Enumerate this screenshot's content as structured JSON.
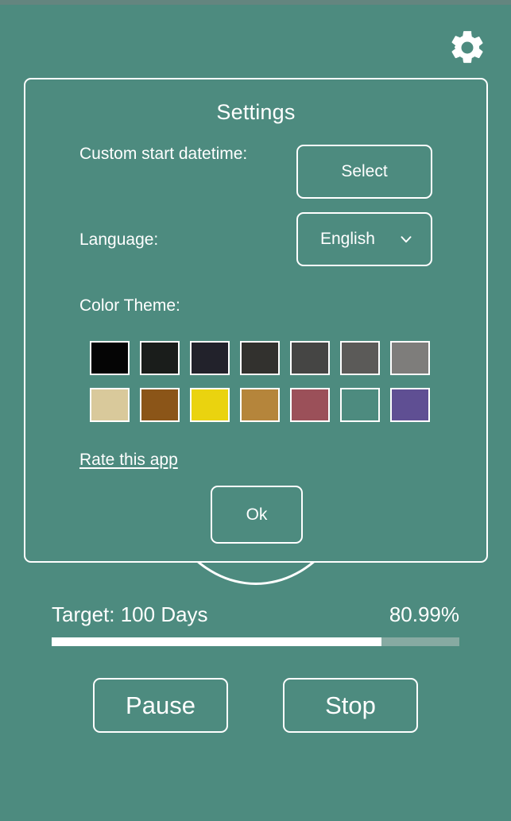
{
  "theme": {
    "background": "#4d8b7f",
    "foreground": "#ffffff",
    "status_bar": "#64857f",
    "progress_track": "#87aaa2"
  },
  "topbar": {
    "gear_icon": "gear-icon"
  },
  "dialog": {
    "title": "Settings",
    "rows": [
      {
        "label": "Custom start datetime:",
        "button_label": "Select"
      },
      {
        "label": "Language:",
        "value": "English",
        "chevron_icon": "chevron-down-icon"
      }
    ],
    "color_theme": {
      "label": "Color Theme:",
      "rows": [
        [
          {
            "name": "swatch-black",
            "color": "#050505"
          },
          {
            "name": "swatch-near-black",
            "color": "#1a1d1b"
          },
          {
            "name": "swatch-dark-navy",
            "color": "#22222b"
          },
          {
            "name": "swatch-dark-gray",
            "color": "#32312e"
          },
          {
            "name": "swatch-gray-1",
            "color": "#454544"
          },
          {
            "name": "swatch-gray-2",
            "color": "#5b5a58"
          },
          {
            "name": "swatch-gray-3",
            "color": "#7e7d7b"
          }
        ],
        [
          {
            "name": "swatch-sand",
            "color": "#d9c99b"
          },
          {
            "name": "swatch-brown",
            "color": "#8b5518"
          },
          {
            "name": "swatch-yellow",
            "color": "#ead30f"
          },
          {
            "name": "swatch-ochre",
            "color": "#b5853b"
          },
          {
            "name": "swatch-maroon",
            "color": "#9b5059"
          },
          {
            "name": "swatch-transparent",
            "color": "transparent"
          },
          {
            "name": "swatch-purple",
            "color": "#5f4f93"
          }
        ]
      ]
    },
    "rate_link": "Rate this app",
    "ok_label": "Ok"
  },
  "bottom": {
    "target_label": "Target: 100 Days",
    "percent_label": "80.99%",
    "progress_value": 80.99,
    "pause_label": "Pause",
    "stop_label": "Stop"
  }
}
